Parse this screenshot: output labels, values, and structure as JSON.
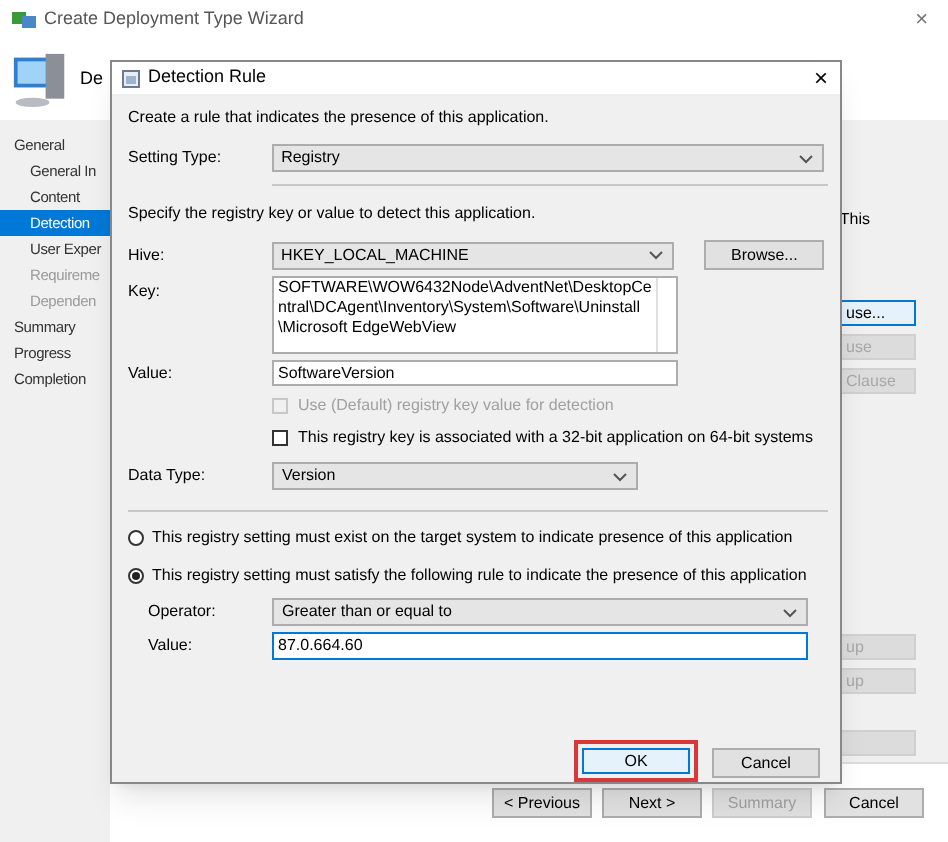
{
  "wizard": {
    "title": "Create Deployment Type Wizard",
    "close": "×",
    "header": "De",
    "nav": [
      {
        "label": "General",
        "selected": false,
        "disabled": false,
        "children": [
          {
            "label": "General In",
            "selected": false,
            "disabled": false
          },
          {
            "label": "Content",
            "selected": false,
            "disabled": false
          },
          {
            "label": "Detection",
            "selected": true,
            "disabled": false
          },
          {
            "label": "User Exper",
            "selected": false,
            "disabled": false
          },
          {
            "label": "Requireme",
            "selected": false,
            "disabled": true
          },
          {
            "label": "Dependen",
            "selected": false,
            "disabled": true
          }
        ]
      },
      {
        "label": "Summary",
        "selected": false,
        "disabled": false
      },
      {
        "label": "Progress",
        "selected": false,
        "disabled": false
      },
      {
        "label": "Completion",
        "selected": false,
        "disabled": false
      }
    ],
    "side_text": "This",
    "side_buttons": [
      {
        "label": "use...",
        "disabled": false,
        "focused": true
      },
      {
        "label": "use",
        "disabled": true,
        "focused": false
      },
      {
        "label": "Clause",
        "disabled": true,
        "focused": false
      },
      {
        "label": "up",
        "disabled": true,
        "focused": false
      },
      {
        "label": "up",
        "disabled": true,
        "focused": false
      },
      {
        "disabled": true,
        "focused": false
      }
    ],
    "buttons": [
      {
        "label": "< Previous",
        "disabled": false
      },
      {
        "label": "Next >",
        "disabled": false
      },
      {
        "label": "Summary",
        "disabled": true
      },
      {
        "label": "Cancel",
        "disabled": false
      }
    ]
  },
  "dialog": {
    "title": "Detection Rule",
    "close": "×",
    "intro": "Create a rule that indicates the presence of this application.",
    "setting_type": {
      "label": "Setting Type:",
      "value": "Registry"
    },
    "specify": "Specify the registry key or value to detect this application.",
    "hive": {
      "label": "Hive:",
      "value": "HKEY_LOCAL_MACHINE"
    },
    "browse": "Browse...",
    "key": {
      "label": "Key:",
      "value": "SOFTWARE\\WOW6432Node\\AdventNet\\DesktopCentral\\DCAgent\\Inventory\\System\\Software\\Uninstall\\Microsoft EdgeWebView"
    },
    "value": {
      "label": "Value:",
      "value": "SoftwareVersion"
    },
    "checkboxes": [
      {
        "label": "Use (Default) registry key value for detection",
        "checked": false,
        "disabled": true
      },
      {
        "label": "This registry key is associated with a 32-bit application on 64-bit systems",
        "checked": false,
        "disabled": false
      }
    ],
    "data_type": {
      "label": "Data Type:",
      "value": "Version"
    },
    "radios": [
      {
        "label": "This registry setting must exist on the target system to indicate presence of this application",
        "selected": false
      },
      {
        "label": "This registry setting must satisfy the following rule to indicate the presence of this application",
        "selected": true
      }
    ],
    "operator": {
      "label": "Operator:",
      "value": "Greater than or equal to"
    },
    "rule_value": {
      "label": "Value:",
      "value": "87.0.664.60"
    },
    "ok": {
      "label": "OK",
      "highlighted": true
    },
    "cancel": "Cancel"
  }
}
